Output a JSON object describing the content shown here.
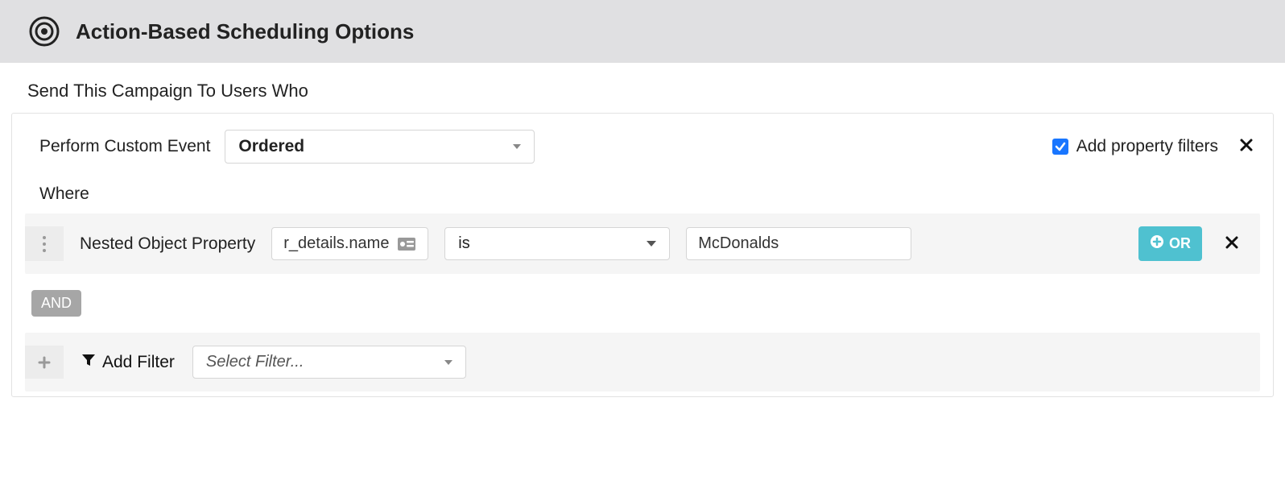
{
  "header": {
    "title": "Action-Based Scheduling Options"
  },
  "section": {
    "subtitle": "Send This Campaign To Users Who"
  },
  "event": {
    "label": "Perform Custom Event",
    "selected": "Ordered",
    "add_filters_label": "Add property filters"
  },
  "where": {
    "label": "Where",
    "filter": {
      "type_label": "Nested Object Property",
      "property_value": "r_details.name",
      "operator": "is",
      "value": "McDonalds",
      "or_label": "OR"
    },
    "and_label": "AND",
    "add_filter": {
      "label": "Add Filter",
      "placeholder": "Select Filter..."
    }
  }
}
